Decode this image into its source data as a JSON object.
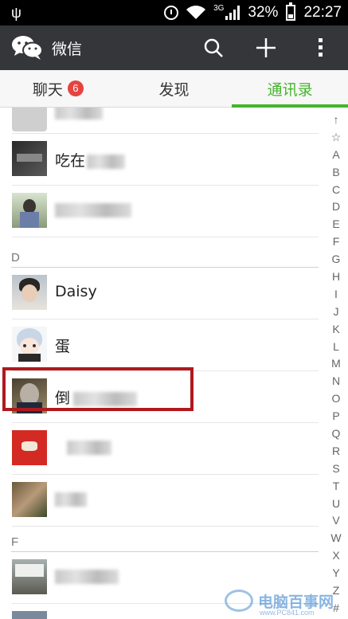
{
  "status_bar": {
    "network": "3G",
    "battery": "32%",
    "time": "22:27"
  },
  "app": {
    "title": "微信"
  },
  "tabs": [
    {
      "label": "聊天",
      "badge": "6"
    },
    {
      "label": "发现"
    },
    {
      "label": "通讯录",
      "active": true
    }
  ],
  "contacts_top": [
    {
      "name_visible": "吃在"
    },
    {
      "name_visible": ""
    }
  ],
  "sections": [
    {
      "letter": "D",
      "contacts": [
        {
          "name_visible": "Daisy"
        },
        {
          "name_visible": "蛋"
        },
        {
          "name_visible": "倒"
        },
        {
          "name_visible": ""
        },
        {
          "name_visible": ""
        }
      ]
    },
    {
      "letter": "F",
      "contacts": [
        {
          "name_visible": ""
        }
      ]
    }
  ],
  "index_bar": [
    "↑",
    "☆",
    "A",
    "B",
    "C",
    "D",
    "E",
    "F",
    "G",
    "H",
    "I",
    "J",
    "K",
    "L",
    "M",
    "N",
    "O",
    "P",
    "Q",
    "R",
    "S",
    "T",
    "U",
    "V",
    "W",
    "X",
    "Y",
    "Z",
    "#"
  ],
  "watermark": {
    "text": "电脑百事网",
    "url": "www.PC841.com"
  },
  "colors": {
    "accent": "#45b42c",
    "action_bar": "#35363a",
    "badge": "#e64340",
    "highlight": "#b0191c"
  }
}
